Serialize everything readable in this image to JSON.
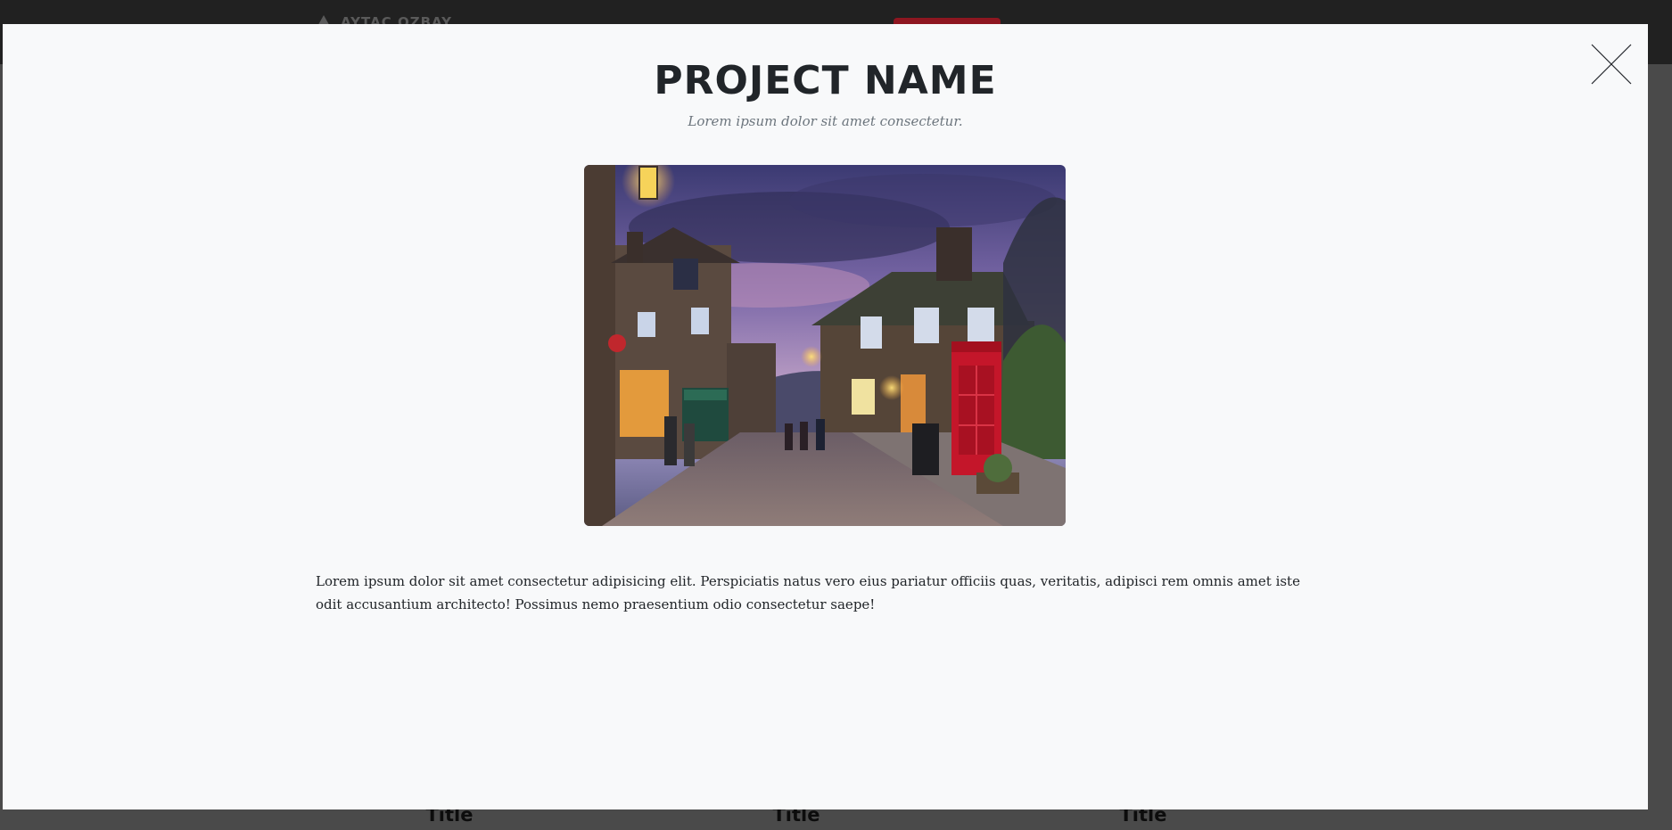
{
  "background": {
    "logo_text": "AYTAC OZBAY",
    "card_titles": [
      "Title",
      "Title",
      "Title"
    ]
  },
  "modal": {
    "title": "PROJECT NAME",
    "subtitle": "Lorem ipsum dolor sit amet consectetur.",
    "image_alt": "Village street with stone houses and a red telephone box at dusk",
    "body": "Lorem ipsum dolor sit amet consectetur adipisicing elit. Perspiciatis natus vero eius pariatur officiis quas, veritatis, adipisci rem omnis amet iste odit accusantium architecto! Possimus nemo praesentium odio consectetur saepe!",
    "close_icon": "close-icon"
  },
  "colors": {
    "modal_background": "#f8f9fa",
    "title": "#212529",
    "subtitle": "#6c757d",
    "overlay": "#4a4a4a",
    "nav_accent": "#8e1620"
  }
}
